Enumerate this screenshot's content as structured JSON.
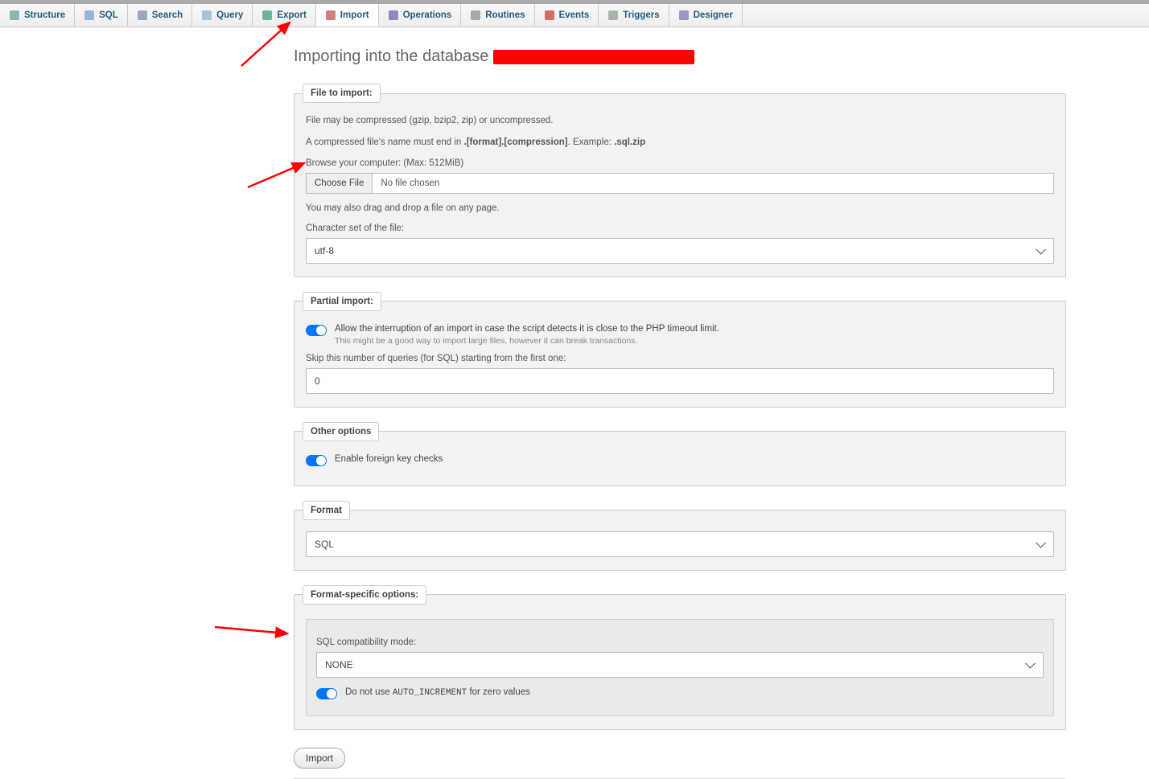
{
  "tabs": [
    {
      "label": "Structure",
      "icon": "structure-icon",
      "color": "#7aa"
    },
    {
      "label": "SQL",
      "icon": "sql-icon",
      "color": "#8aa8d0"
    },
    {
      "label": "Search",
      "icon": "search-icon",
      "color": "#89b"
    },
    {
      "label": "Query",
      "icon": "query-icon",
      "color": "#9bc"
    },
    {
      "label": "Export",
      "icon": "export-icon",
      "color": "#5a8"
    },
    {
      "label": "Import",
      "icon": "import-icon",
      "color": "#c66",
      "active": true
    },
    {
      "label": "Operations",
      "icon": "operations-icon",
      "color": "#77b"
    },
    {
      "label": "Routines",
      "icon": "routines-icon",
      "color": "#999"
    },
    {
      "label": "Events",
      "icon": "events-icon",
      "color": "#c55"
    },
    {
      "label": "Triggers",
      "icon": "triggers-icon",
      "color": "#9a9"
    },
    {
      "label": "Designer",
      "icon": "designer-icon",
      "color": "#88b"
    }
  ],
  "page_title_prefix": "Importing into the database ",
  "file_to_import": {
    "legend": "File to import:",
    "help1_a": "File may be compressed (gzip, bzip2, zip) or uncompressed.",
    "help2_a": "A compressed file's name must end in ",
    "help2_b": ".[format].[compression]",
    "help2_c": ". Example: ",
    "help2_d": ".sql.zip",
    "browse_label": "Browse your computer: (Max: 512MiB)",
    "choose_btn": "Choose File",
    "no_file": "No file chosen",
    "dragdrop": "You may also drag and drop a file on any page.",
    "charset_label": "Character set of the file:",
    "charset_value": "utf-8"
  },
  "partial_import": {
    "legend": "Partial import:",
    "toggle_label": "Allow the interruption of an import in case the script detects it is close to the PHP timeout limit.",
    "toggle_sub": "This might be a good way to import large files, however it can break transactions.",
    "skip_label": "Skip this number of queries (for SQL) starting from the first one:",
    "skip_value": "0"
  },
  "other_options": {
    "legend": "Other options",
    "fk_label": "Enable foreign key checks"
  },
  "format": {
    "legend": "Format",
    "value": "SQL"
  },
  "format_specific": {
    "legend": "Format-specific options:",
    "compat_label": "SQL compatibility mode:",
    "compat_value": "NONE",
    "autoinc_a": "Do not use ",
    "autoinc_b": "AUTO_INCREMENT",
    "autoinc_c": " for zero values"
  },
  "import_button": "Import"
}
